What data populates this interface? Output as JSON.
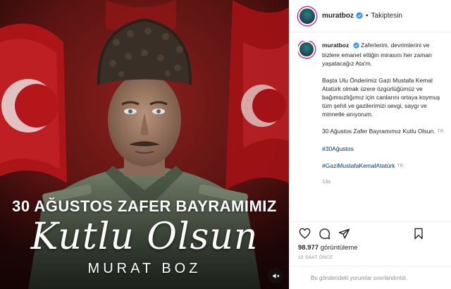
{
  "media": {
    "poster_line1": "30 AĞUSTOS ZAFER BAYRAMIMIZ",
    "poster_line2": "Kutlu Olsun",
    "poster_line3": "MURAT BOZ",
    "colors": {
      "flag_red": "#b5161a",
      "uniform": "#5d6b57",
      "hat": "#3a2f26"
    }
  },
  "header": {
    "username": "muratboz",
    "separator": "•",
    "follow_state": "Takiptesin"
  },
  "caption": {
    "username": "muratboz",
    "para1": "Zaferlerini, devrimlerini ve bizlere emanet ettiğin mirasını her zaman yaşatacağız Ata'm.",
    "para2": "Başta Ulu Önderimiz Gazi Mustafa Kemal Atatürk olmak üzere özgürlüğümüz ve bağımsızlığımız için canlarını ortaya koymuş tüm şehit ve gazilerimizi sevgi, saygı ve minnetle anıyorum.",
    "para3": "30 Ağustos Zafer Bayramımız Kutlu Olsun.",
    "translate_tag": "TR",
    "hashtag1": "#30Ağustos",
    "hashtag2": "#GaziMustafaKemalAtatürk",
    "time_ago": "13s"
  },
  "stats": {
    "views_count": "98.977",
    "views_label": "görüntüleme",
    "posted_ago": "13 SAAT ÖNCE"
  },
  "footer": {
    "comments_disabled": "Bu gönderideki yorumlar sınırlandırıldı."
  },
  "icons": [
    "verified-icon",
    "heart-icon",
    "comment-icon",
    "share-icon",
    "bookmark-icon",
    "mute-icon"
  ]
}
